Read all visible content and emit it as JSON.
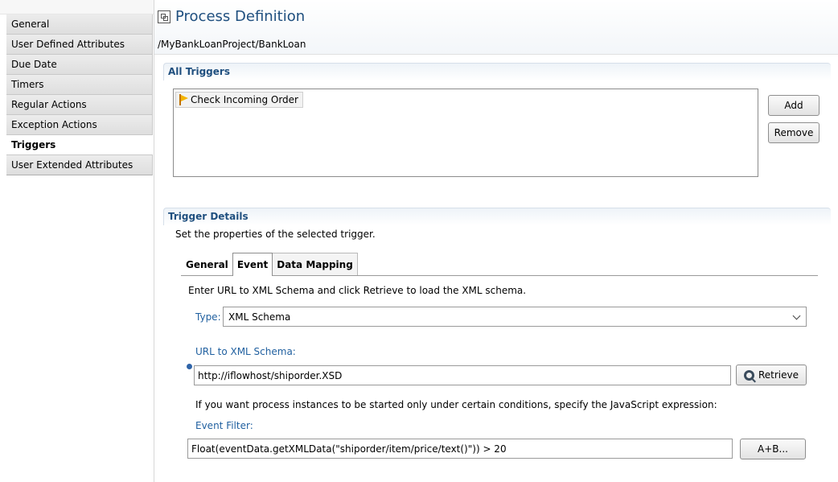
{
  "sidebar": {
    "items": [
      {
        "label": "General"
      },
      {
        "label": "User Defined Attributes"
      },
      {
        "label": "Due Date"
      },
      {
        "label": "Timers"
      },
      {
        "label": "Regular Actions"
      },
      {
        "label": "Exception Actions"
      },
      {
        "label": "Triggers"
      },
      {
        "label": "User Extended Attributes"
      }
    ],
    "active": "Triggers"
  },
  "header": {
    "title": "Process Definition",
    "path": "/MyBankLoanProject/BankLoan"
  },
  "all_triggers": {
    "section_title": "All Triggers",
    "items": [
      "Check Incoming Order"
    ],
    "add_label": "Add",
    "remove_label": "Remove"
  },
  "trigger_details": {
    "section_title": "Trigger Details",
    "description": "Set the properties of the selected trigger.",
    "tabs": [
      "General",
      "Event",
      "Data Mapping"
    ],
    "active_tab": "Event",
    "event": {
      "instruction": "Enter URL to XML Schema and click Retrieve to load the XML schema.",
      "type_label": "Type:",
      "type_value": "XML Schema",
      "url_label": "URL to XML Schema:",
      "url_value": "http://iflowhost/shiporder.XSD",
      "retrieve_label": "Retrieve",
      "condition_text": "If you want process instances to be started only under certain conditions, specify the JavaScript expression:",
      "filter_label": "Event Filter:",
      "filter_value": "Float(eventData.getXMLData(\"shiporder/item/price/text()\")) > 20",
      "expr_button_label": "A+B..."
    }
  },
  "colors": {
    "section_title": "#1f4f7f",
    "field_label": "#1f5f9f"
  }
}
